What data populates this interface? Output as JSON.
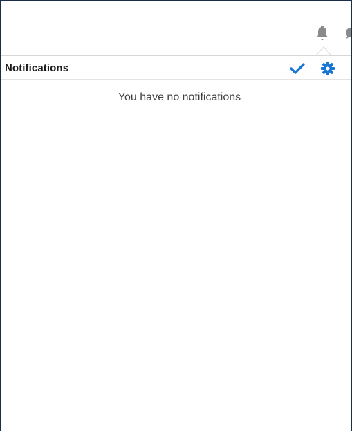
{
  "panel": {
    "title": "Notifications",
    "empty_message": "You have no notifications"
  },
  "icons": {
    "bell": "bell-icon",
    "mark_all_read": "checkmark-icon",
    "settings": "gear-icon"
  },
  "colors": {
    "accent": "#1976d2",
    "frame": "#1a2e48",
    "icon_gray": "#8a8a8a"
  }
}
